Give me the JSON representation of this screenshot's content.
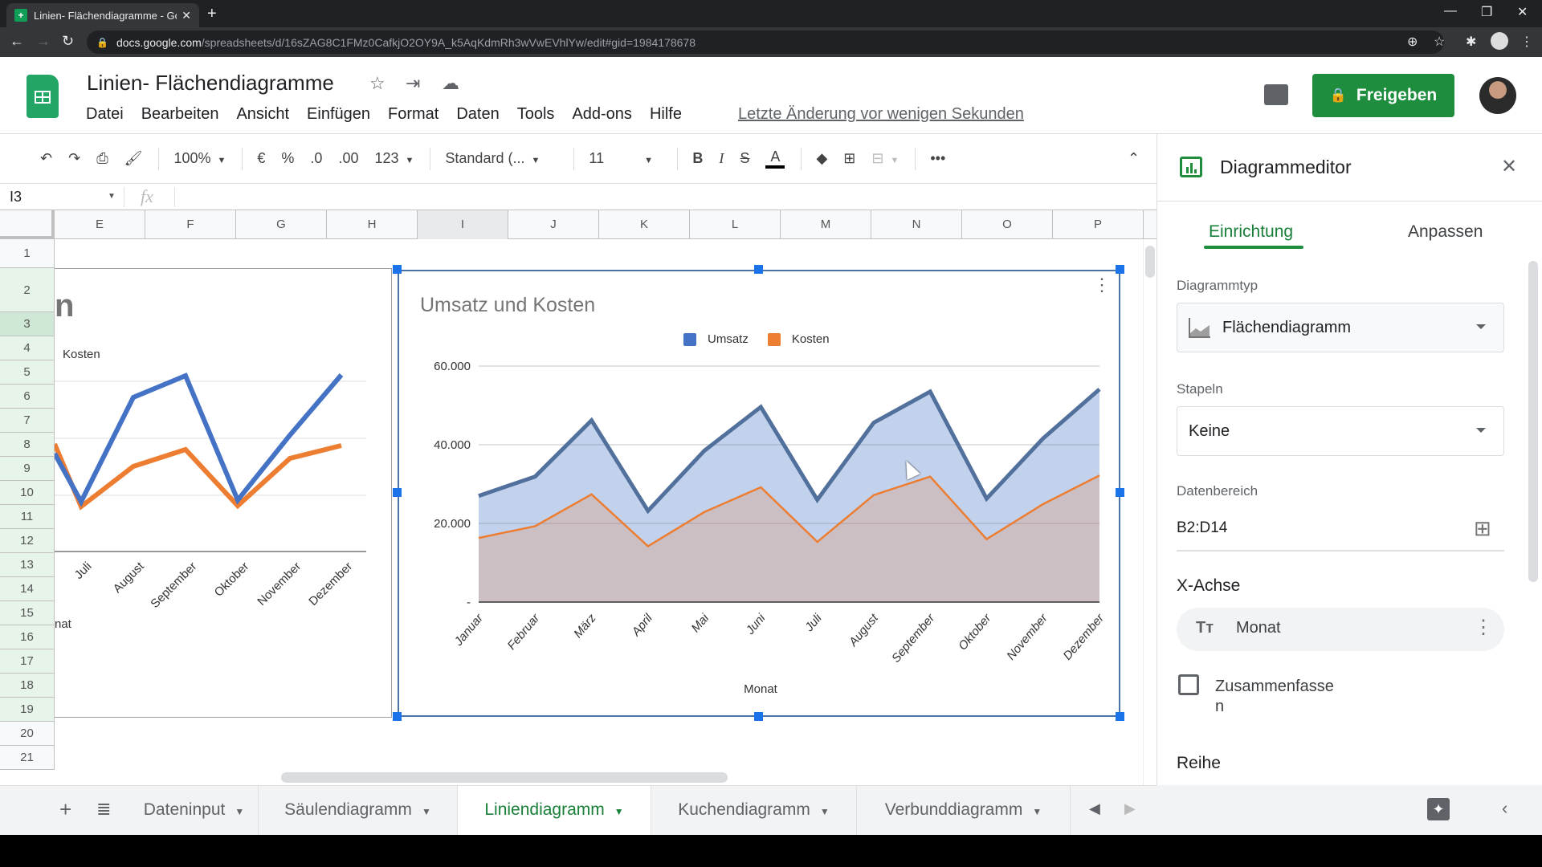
{
  "browser": {
    "tab_title": "Linien- Flächendiagramme - Goo",
    "url_host": "docs.google.com",
    "url_path": "/spreadsheets/d/16sZAG8C1FMz0CafkjO2OY9A_k5AqKdmRh3wVwEVhlYw/edit#gid=1984178678"
  },
  "app": {
    "doc_title": "Linien- Flächendiagramme",
    "menu": [
      "Datei",
      "Bearbeiten",
      "Ansicht",
      "Einfügen",
      "Format",
      "Daten",
      "Tools",
      "Add-ons",
      "Hilfe"
    ],
    "last_edit": "Letzte Änderung vor wenigen Sekunden",
    "share_label": "Freigeben"
  },
  "toolbar": {
    "zoom": "100%",
    "currency": "€",
    "percent": "%",
    "dec_less": ".0",
    "dec_more": ".00",
    "more_formats": "123",
    "font": "Standard (...",
    "font_size": "11",
    "bold": "B",
    "italic": "I",
    "strike": "S",
    "text_color": "A",
    "more": "•••"
  },
  "formula_bar": {
    "cell_ref": "I3",
    "fx": "fx",
    "value": ""
  },
  "sheet": {
    "columns": [
      "E",
      "F",
      "G",
      "H",
      "I",
      "J",
      "K",
      "L",
      "M",
      "N",
      "O",
      "P"
    ],
    "selected_column": "I",
    "rows": [
      "1",
      "2",
      "3",
      "4",
      "5",
      "6",
      "7",
      "8",
      "9",
      "10",
      "11",
      "12",
      "13",
      "14",
      "15",
      "16",
      "17",
      "18",
      "19",
      "20",
      "21"
    ],
    "selected_row": "3"
  },
  "left_chart": {
    "title_fragment": "n",
    "legend_fragment": "Kosten",
    "xlabel_fragment": "nat",
    "categories": [
      "Juli",
      "August",
      "September",
      "Oktober",
      "November",
      "Dezember"
    ]
  },
  "chart_data": {
    "type": "area",
    "title": "Umsatz und Kosten",
    "xlabel": "Monat",
    "ylabel": "",
    "categories": [
      "Januar",
      "Februar",
      "März",
      "April",
      "Mai",
      "Juni",
      "Juli",
      "August",
      "September",
      "Oktober",
      "November",
      "Dezember"
    ],
    "series": [
      {
        "name": "Umsatz",
        "color": "#4472c4",
        "values": [
          27000,
          31900,
          46200,
          23200,
          38500,
          49600,
          26000,
          45600,
          53500,
          26300,
          41600,
          54100
        ]
      },
      {
        "name": "Kosten",
        "color": "#ed7d31",
        "values": [
          16300,
          19300,
          27400,
          14200,
          22900,
          29200,
          15300,
          27200,
          31900,
          16000,
          24900,
          32200
        ]
      }
    ],
    "ylim": [
      0,
      60000
    ],
    "yticks": [
      0,
      20000,
      40000,
      60000
    ],
    "ytick_labels": [
      "-",
      "20.000",
      "40.000",
      "60.000"
    ],
    "grid": true,
    "legend": "top"
  },
  "panel": {
    "title": "Diagrammeditor",
    "tabs": [
      "Einrichtung",
      "Anpassen"
    ],
    "active_tab": "Einrichtung",
    "chart_type_label": "Diagrammtyp",
    "chart_type": "Flächendiagramm",
    "stack_label": "Stapeln",
    "stack_value": "Keine",
    "range_label": "Datenbereich",
    "range_value": "B2:D14",
    "xaxis_heading": "X-Achse",
    "xaxis_value": "Monat",
    "aggregate_label": "Zusammenfasse\nn",
    "aggregate_checked": false,
    "series_heading": "Reihe"
  },
  "sheet_tabs": [
    {
      "label": "Dateninput",
      "active": false
    },
    {
      "label": "Säulendiagramm",
      "active": false
    },
    {
      "label": "Liniendiagramm",
      "active": true
    },
    {
      "label": "Kuchendiagramm",
      "active": false
    },
    {
      "label": "Verbunddiagramm",
      "active": false
    }
  ],
  "colors": {
    "brand_green": "#1e8e3e",
    "active_tab_green": "#188038",
    "selection_blue": "#1a73e8"
  }
}
